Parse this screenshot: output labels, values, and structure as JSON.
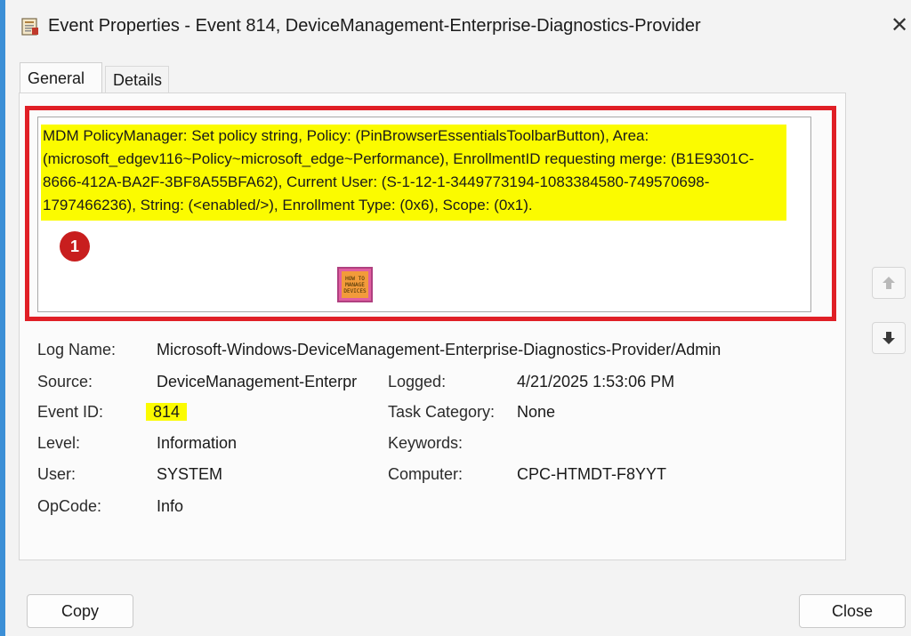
{
  "window": {
    "title": "Event Properties - Event 814, DeviceManagement-Enterprise-Diagnostics-Provider",
    "close_glyph": "✕"
  },
  "tabs": [
    {
      "label": "General",
      "active": true
    },
    {
      "label": "Details",
      "active": false
    }
  ],
  "description": "MDM PolicyManager: Set policy string, Policy: (PinBrowserEssentialsToolbarButton), Area: (microsoft_edgev116~Policy~microsoft_edge~Performance), EnrollmentID requesting merge: (B1E9301C-8666-412A-BA2F-3BF8A55BFA62), Current User: (S-1-12-1-3449773194-1083384580-749570698-1797466236), String: (<enabled/>), Enrollment Type: (0x6), Scope: (0x1).",
  "annotation": {
    "number": "1",
    "color": "#c81e1e",
    "outline_color": "#e01f26"
  },
  "logo": {
    "lines": [
      "HOW TO",
      "MANAGE",
      "DEVICES"
    ]
  },
  "fields": {
    "log_name": {
      "label": "Log Name:",
      "value": "Microsoft-Windows-DeviceManagement-Enterprise-Diagnostics-Provider/Admin"
    },
    "source": {
      "label": "Source:",
      "value": "DeviceManagement-Enterpr"
    },
    "logged": {
      "label": "Logged:",
      "value": "4/21/2025 1:53:06 PM"
    },
    "event_id": {
      "label": "Event ID:",
      "value": "814"
    },
    "task_category": {
      "label": "Task Category:",
      "value": "None"
    },
    "level": {
      "label": "Level:",
      "value": "Information"
    },
    "keywords": {
      "label": "Keywords:",
      "value": ""
    },
    "user": {
      "label": "User:",
      "value": "SYSTEM"
    },
    "computer": {
      "label": "Computer:",
      "value": "CPC-HTMDT-F8YYT"
    },
    "opcode": {
      "label": "OpCode:",
      "value": "Info"
    }
  },
  "buttons": {
    "copy": "Copy",
    "close": "Close"
  },
  "colors": {
    "highlight": "#fbfb00",
    "frame": "#3c8fd6"
  }
}
